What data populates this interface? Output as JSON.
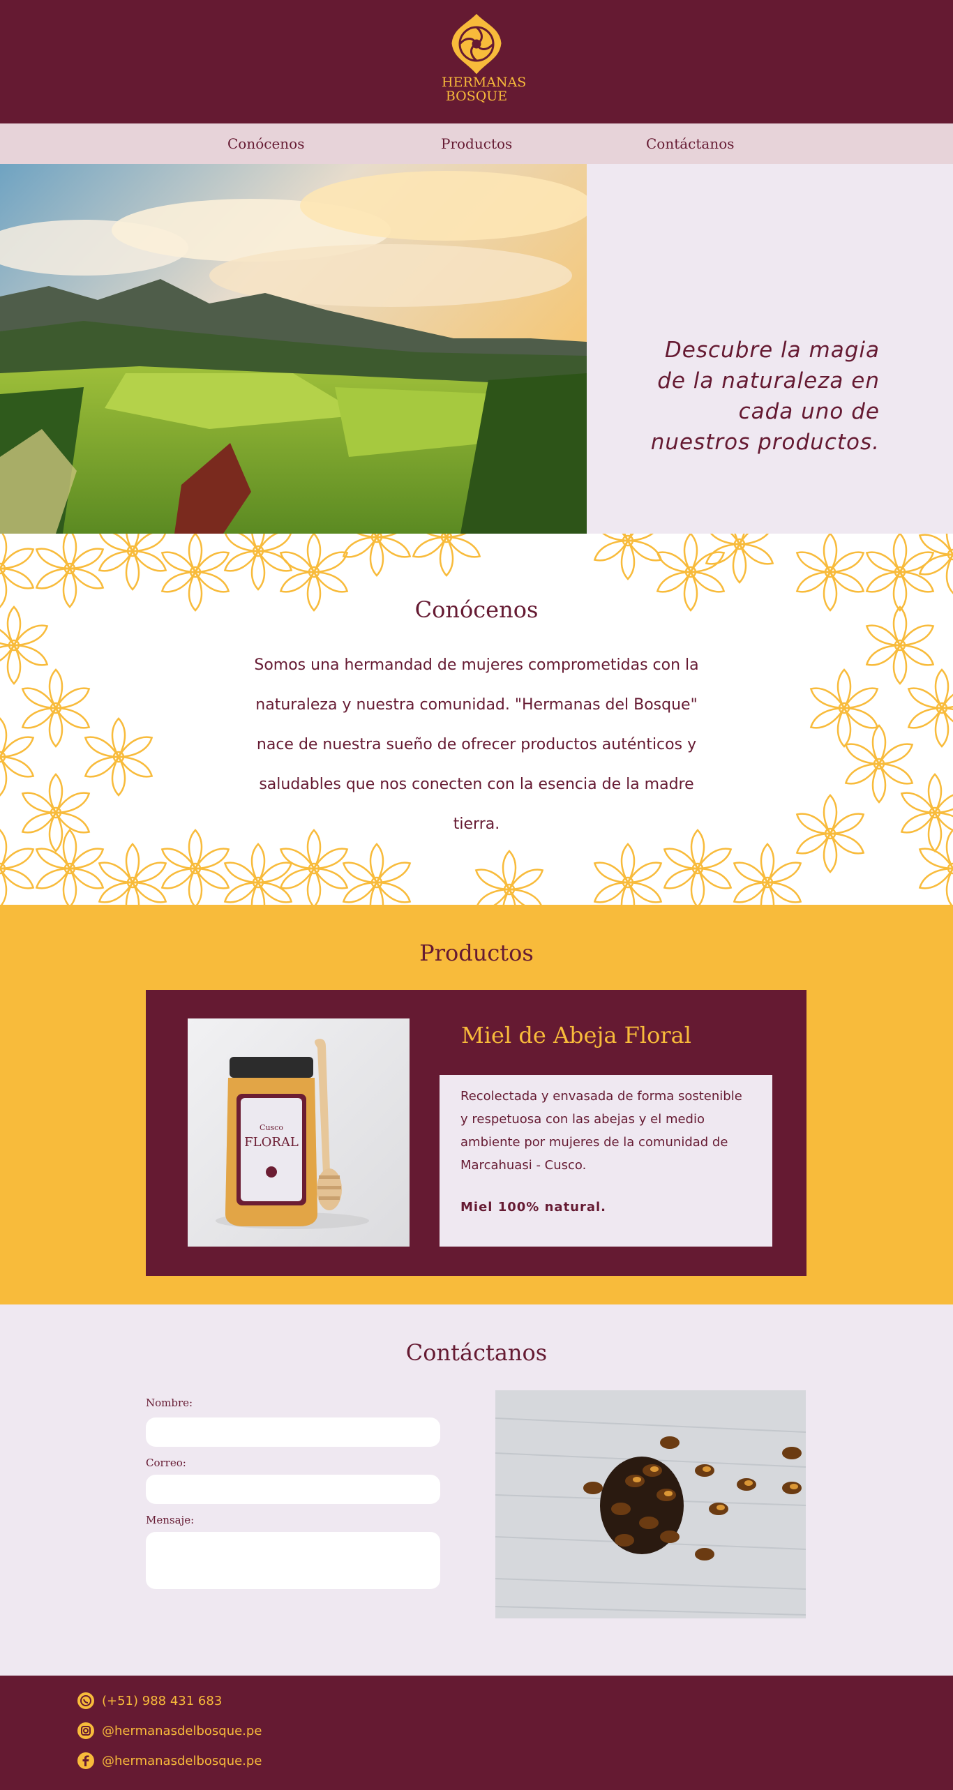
{
  "header": {
    "logo_line1": "HERMANAS",
    "logo_line2": "BOSQUE"
  },
  "nav": {
    "items": [
      {
        "label": "Conócenos"
      },
      {
        "label": "Productos"
      },
      {
        "label": "Contáctanos"
      }
    ]
  },
  "hero": {
    "tagline": "Descubre la magia de la naturaleza en cada uno de nuestros productos."
  },
  "about": {
    "title": "Conócenos",
    "text": "Somos una hermandad de mujeres comprometidas con la naturaleza y nuestra comunidad. \"Hermanas del Bosque\" nace de nuestra sueño de  ofrecer productos auténticos y saludables que nos conecten con la esencia de la madre tierra."
  },
  "products": {
    "title": "Productos",
    "items": [
      {
        "name": "Miel de Abeja Floral",
        "description": "Recolectada y envasada de forma sostenible y respetuosa con las abejas y el medio ambiente por mujeres de la comunidad de Marcahuasi - Cusco.",
        "tag": "Miel 100% natural.",
        "jar_label_top": "Cusco",
        "jar_label_main": "FLORAL"
      }
    ]
  },
  "contact": {
    "title": "Contáctanos",
    "name_label": "Nombre:",
    "email_label": "Correo:",
    "message_label": "Mensaje:",
    "name_value": "",
    "email_value": "",
    "message_value": ""
  },
  "footer": {
    "phone": "(+51) 988 431 683",
    "instagram": "@hermanasdelbosque.pe",
    "facebook": "@hermanasdelbosque.pe"
  },
  "colors": {
    "maroon": "#651a32",
    "gold": "#f8bb3b",
    "lavender": "#efe8f1",
    "nav_pink": "#e7d3d9"
  },
  "icons": {
    "phone": "whatsapp-icon",
    "instagram": "instagram-icon",
    "facebook": "facebook-icon"
  }
}
